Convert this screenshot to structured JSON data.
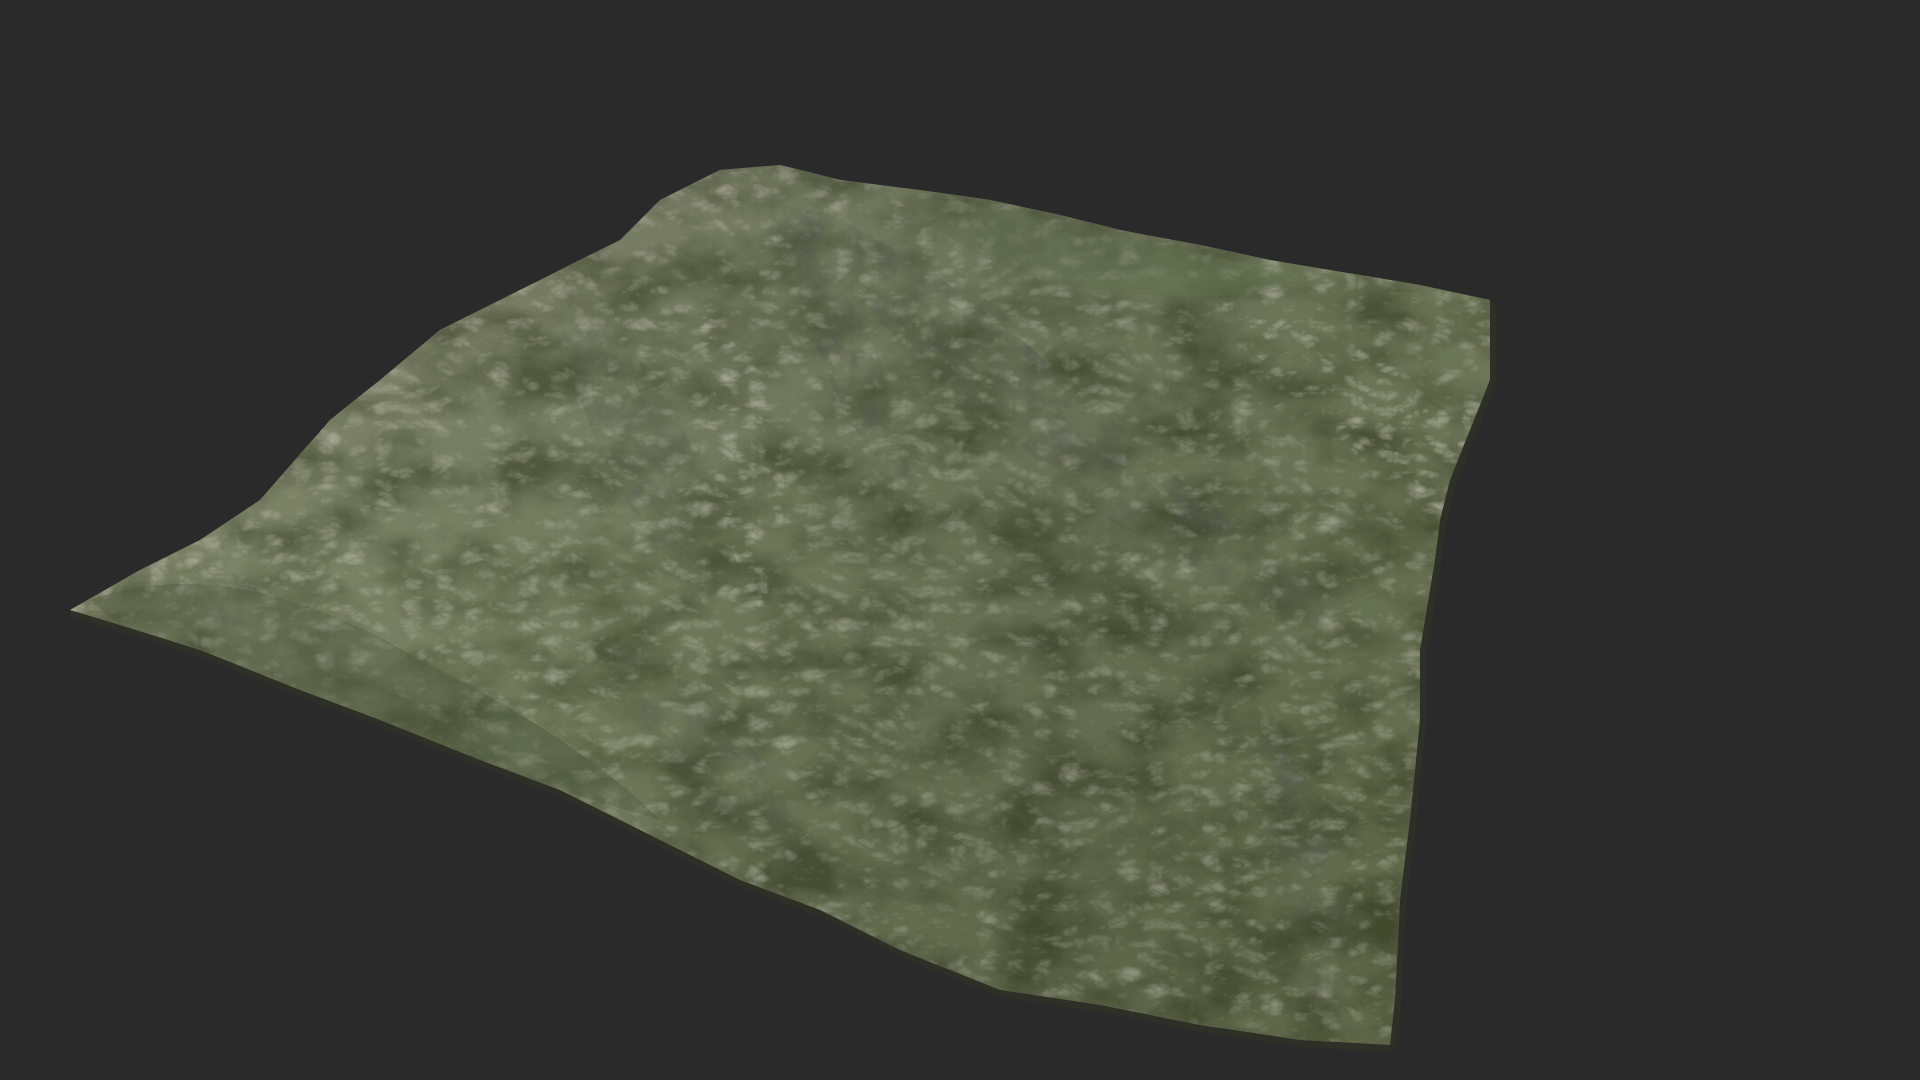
{
  "viewport": {
    "background_color": "#2a2a2a"
  },
  "terrain": {
    "colors": {
      "grass": "#6f7f5c",
      "grass_dark": "#4e5a3f",
      "rock_light": "#b3ad97",
      "rock_mid": "#8f8b78",
      "shadow": "#3c3f33",
      "deep_shadow": "#262a22",
      "edge": "#2f3128"
    }
  }
}
